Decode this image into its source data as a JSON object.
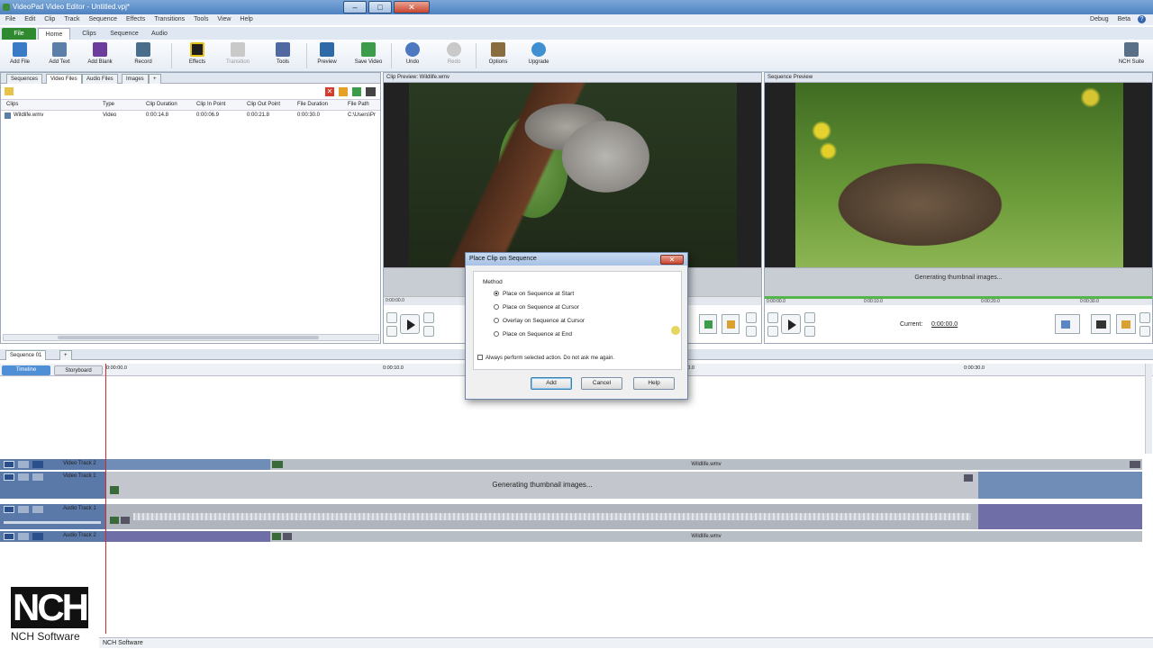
{
  "window": {
    "title": "VideoPad Video Editor - Untitled.vpj*",
    "brand": "NCH Software"
  },
  "menu": {
    "items": [
      "File",
      "Edit",
      "Clip",
      "Track",
      "Sequence",
      "Effects",
      "Transitions",
      "Tools",
      "View",
      "Help"
    ],
    "right_items": [
      "Debug",
      "Beta"
    ]
  },
  "ribbon_tabs": [
    "File",
    "Home",
    "Clips",
    "Sequence",
    "Audio"
  ],
  "ribbon": {
    "add_file": "Add File",
    "add_text": "Add Text",
    "add_blank": "Add Blank",
    "record": "Record",
    "effects": "Effects",
    "transition": "Transition",
    "tools": "Tools",
    "preview": "Preview",
    "save_video": "Save Video",
    "undo": "Undo",
    "redo": "Redo",
    "options": "Options",
    "upgrade": "Upgrade",
    "nch_suite": "NCH Suite"
  },
  "media_panel": {
    "tabs": [
      "Sequences",
      "Video Files",
      "Audio Files",
      "Images",
      "+"
    ],
    "columns": [
      "Clips",
      "Type",
      "Clip Duration",
      "Clip In Point",
      "Clip Out Point",
      "File Duration",
      "File Path"
    ],
    "rows": [
      [
        "Wildlife.wmv",
        "Video",
        "0:00:14.8",
        "0:00:06.9",
        "0:00:21.8",
        "0:00:30.0",
        "C:\\Users\\Pr"
      ]
    ]
  },
  "clip_preview": {
    "title": "Clip Preview: Wildlife.wmv",
    "timecode": "0:00:00.0"
  },
  "sequence_preview": {
    "title": "Sequence Preview",
    "status": "Generating thumbnail images...",
    "current_label": "Current:",
    "current_value": "0:00:00.0",
    "timecodes": [
      "0:00:00.0",
      "0:00:10.0",
      "0:00:20.0",
      "0:00:30.0"
    ]
  },
  "timeline": {
    "sequence_tab": "Sequence 01",
    "add_tab": "+",
    "view_tabs": [
      "Timeline",
      "Storyboard"
    ],
    "ruler": [
      "0:00:00.0",
      "0:00:10.0",
      "0:00:20.0",
      "0:00:30.0"
    ],
    "tracks": [
      "Video Track 2",
      "Video Track 1",
      "Audio Track 1",
      "Audio Track 2"
    ],
    "clip_label": "Wildlife.wmv",
    "generating": "Generating thumbnail images..."
  },
  "dialog": {
    "title": "Place Clip on Sequence",
    "method_label": "Method",
    "options": [
      "Place on Sequence at Start",
      "Place on Sequence at Cursor",
      "Overlay on Sequence at Cursor",
      "Place on Sequence at End"
    ],
    "selected_index": 0,
    "checkbox_label": "Always perform selected action. Do not ask me again.",
    "buttons": {
      "add": "Add",
      "cancel": "Cancel",
      "help": "Help"
    }
  },
  "status_bar": {
    "text": "NCH Software"
  },
  "logo": {
    "letters": "NCH",
    "text": "NCH Software"
  },
  "colors": {
    "accent": "#2f8a2f",
    "track_header": "#5a78a8",
    "video_track": "#6f8db7",
    "audio_track": "#6f6ea6"
  }
}
